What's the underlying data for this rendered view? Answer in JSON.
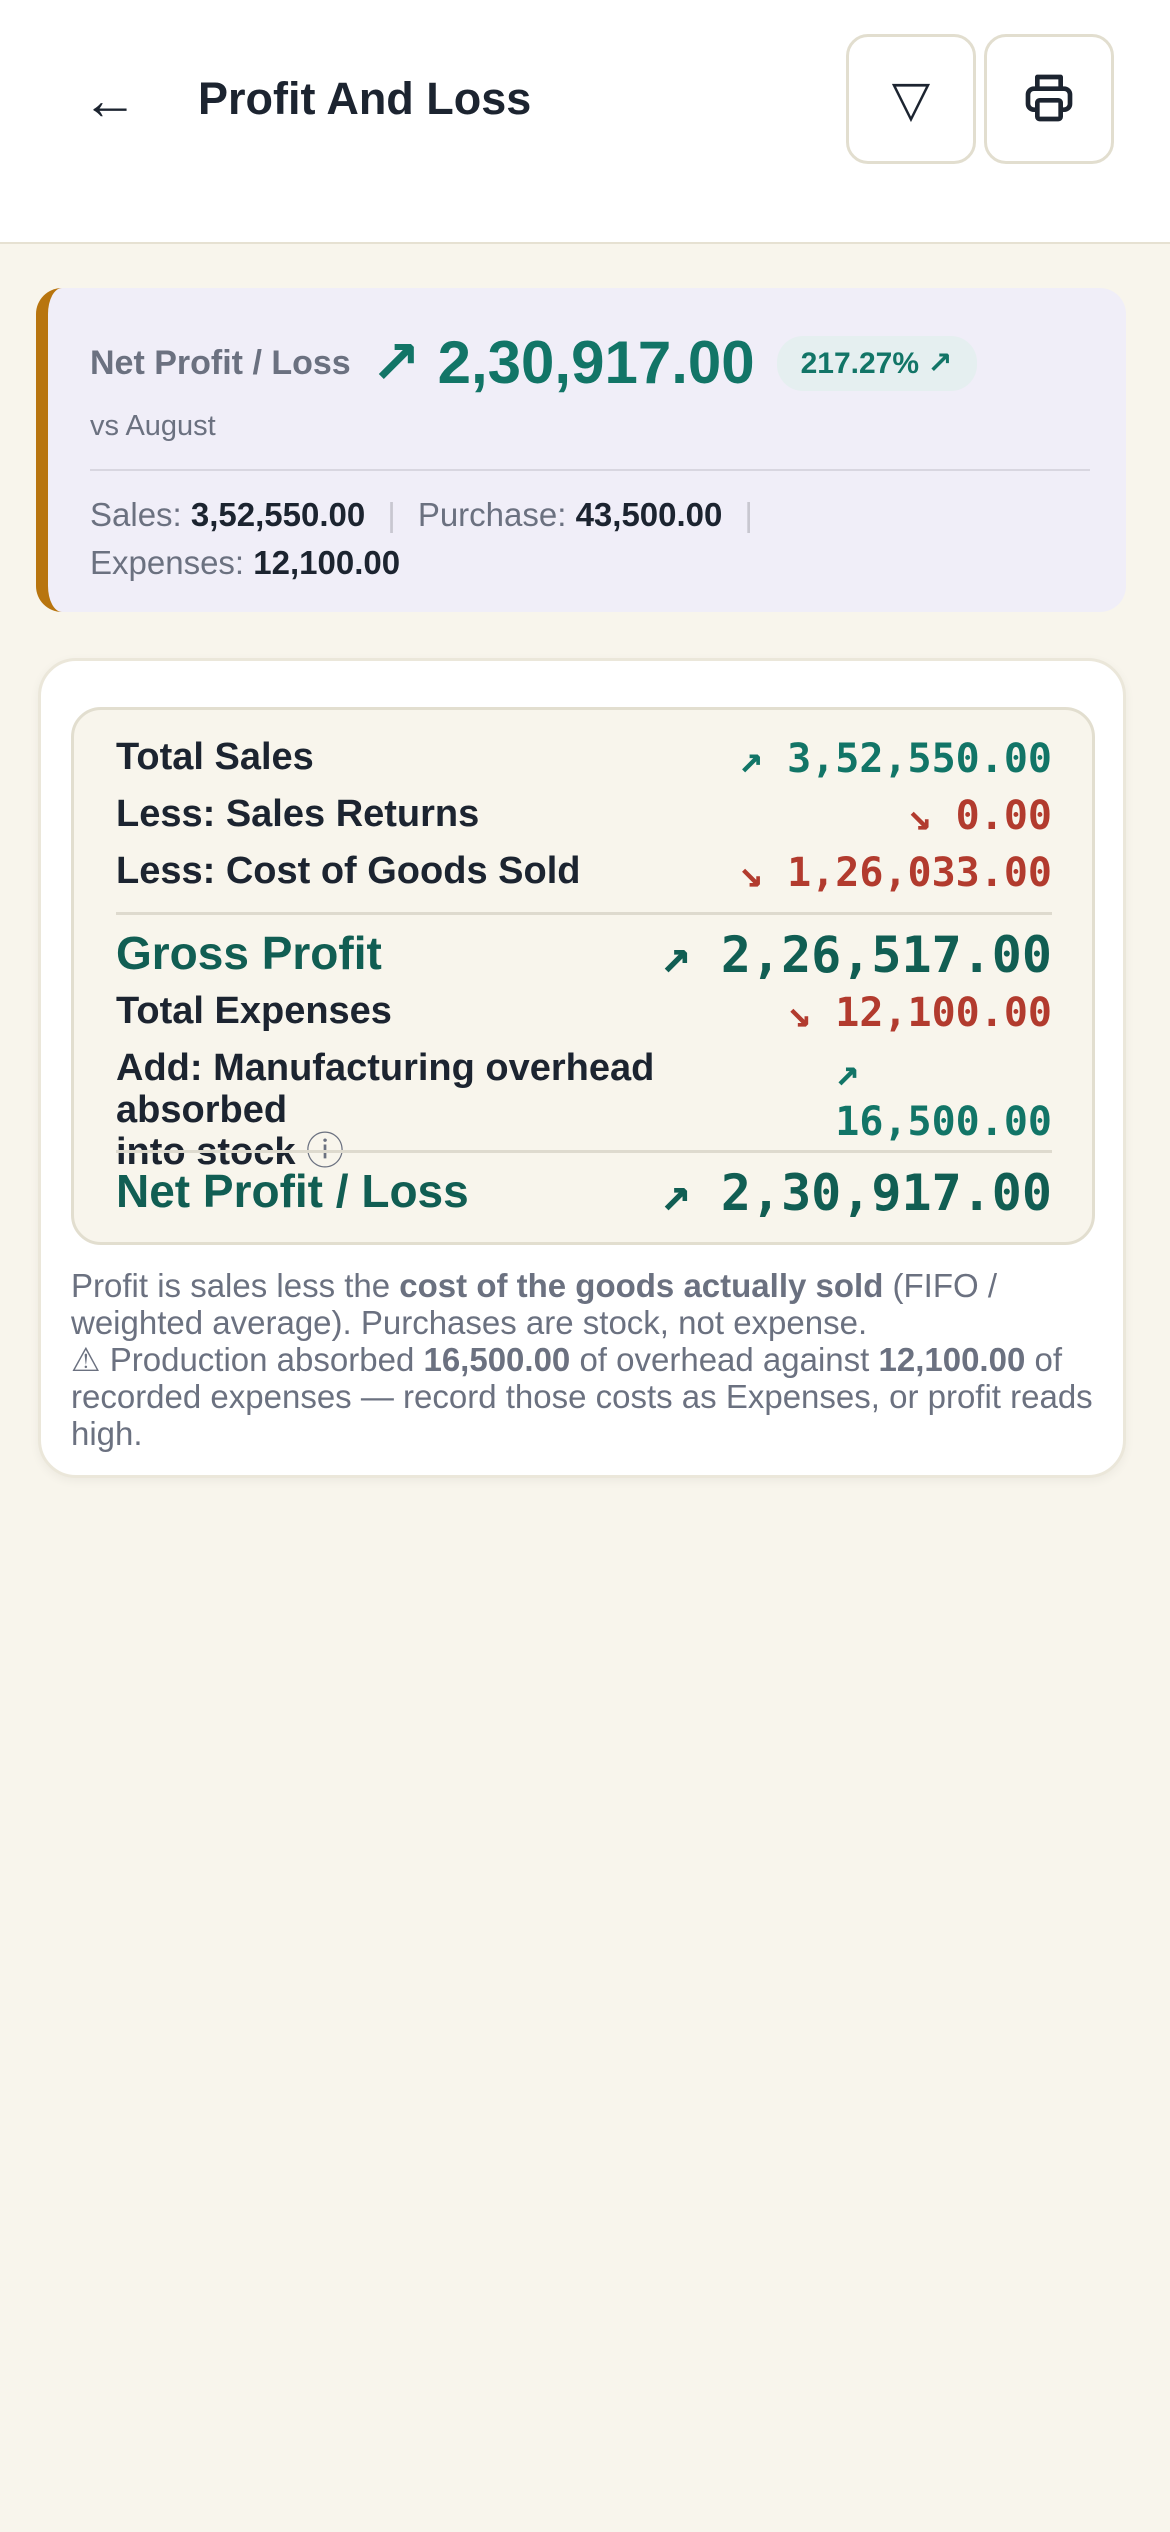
{
  "header": {
    "back_icon": "←",
    "title": "Profit And Loss",
    "filter_icon": "▽",
    "print_icon": "printer-icon"
  },
  "summary": {
    "label": "Net Profit / Loss",
    "value": "↗ 2,30,917.00",
    "change_badge": "217.27% ↗",
    "comparison": "vs August",
    "sales_label": "Sales:",
    "sales_value": "3,52,550.00",
    "purchase_label": "Purchase:",
    "purchase_value": "43,500.00",
    "expenses_label": "Expenses:",
    "expenses_value": "12,100.00",
    "separator": "|",
    "accent_color": "#b8750f"
  },
  "statement": {
    "total_sales_label": "Total Sales",
    "total_sales_value": "↗ 3,52,550.00",
    "sales_returns_label": "Less: Sales Returns",
    "sales_returns_value": "↘ 0.00",
    "cogs_label": "Less: Cost of Goods Sold",
    "cogs_value": "↘ 1,26,033.00",
    "gross_profit_label": "Gross Profit",
    "gross_profit_value": "↗ 2,26,517.00",
    "total_expenses_label": "Total Expenses",
    "total_expenses_value": "↘ 12,100.00",
    "overhead_label_line1": "Add: Manufacturing overhead absorbed",
    "overhead_label_line2": "into stock",
    "overhead_info_icon": "ⓘ",
    "overhead_arrow": "↗",
    "overhead_value": "16,500.00",
    "net_label": "Net Profit / Loss",
    "net_value": "↗ 2,30,917.00",
    "positive_color": "#127567",
    "negative_color": "#b23b2e"
  },
  "note": {
    "p1_a": "Profit is sales less the ",
    "p1_b": "cost of the goods actually sold",
    "p1_c": " (FIFO / weighted average). Purchases are stock, not expense.",
    "p2_a": "⚠ Production absorbed ",
    "p2_b": "16,500.00",
    "p2_c": " of overhead against ",
    "p2_d": "12,100.00",
    "p2_e": " of recorded expenses — record those costs as Expenses, or profit reads high."
  }
}
